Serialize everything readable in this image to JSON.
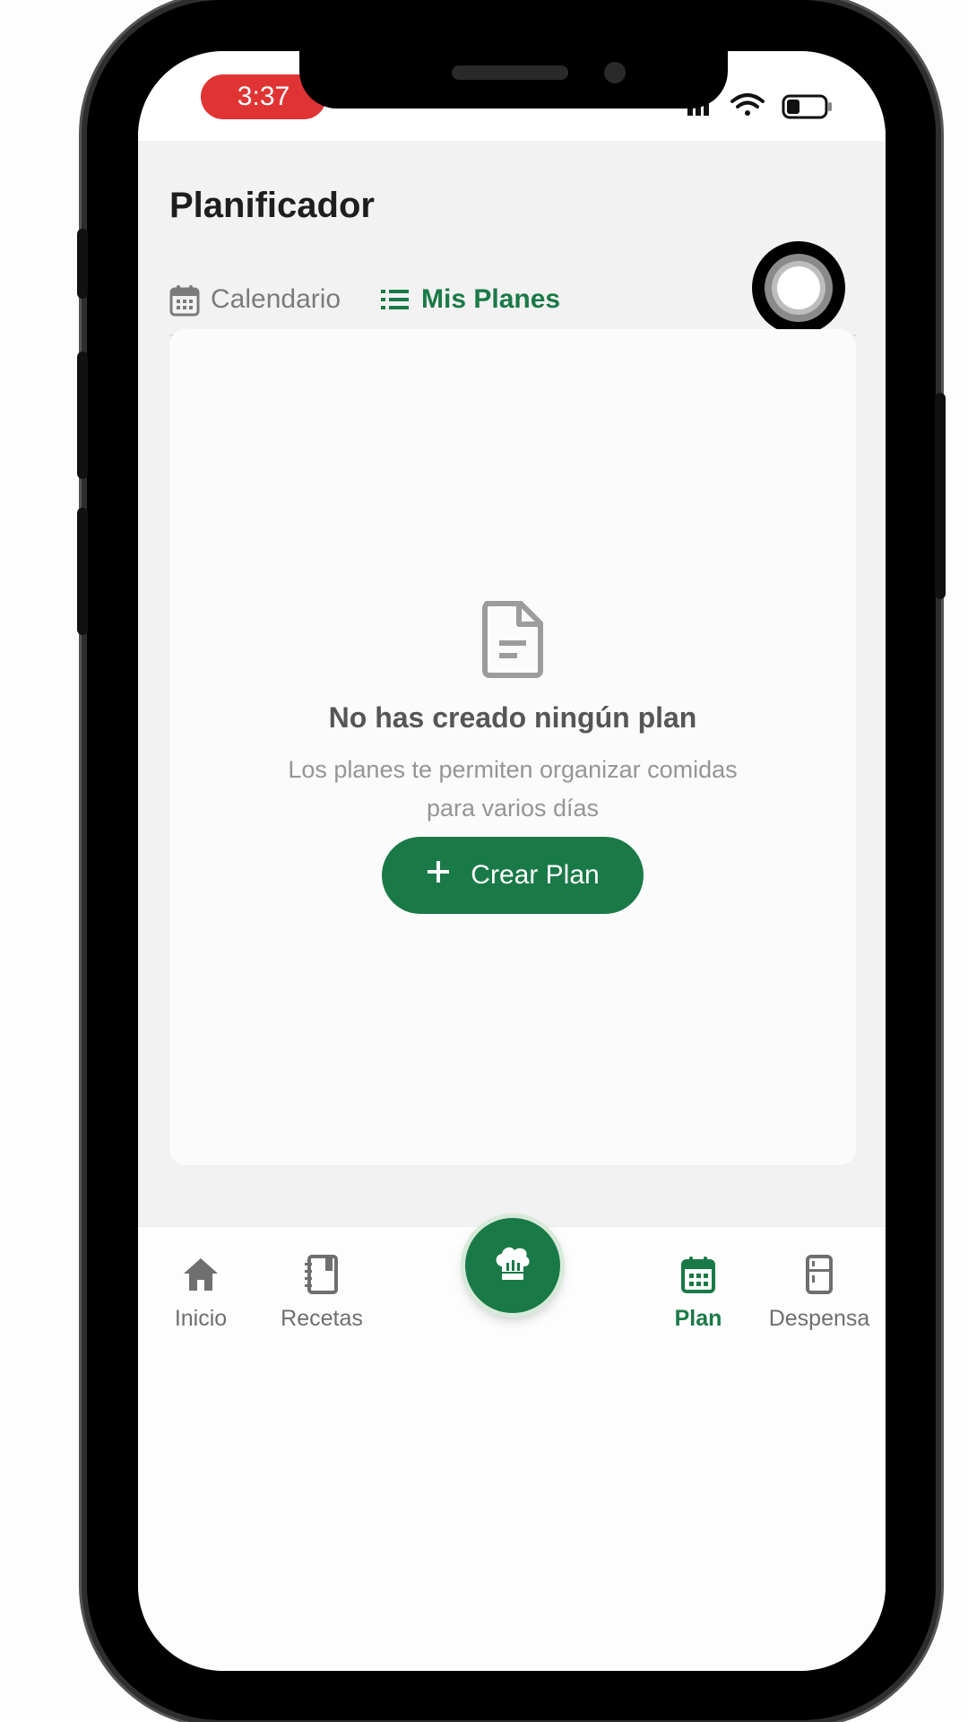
{
  "status_bar": {
    "time": "3:37"
  },
  "header": {
    "title": "Planificador"
  },
  "tabs": [
    {
      "label": "Calendario",
      "icon": "calendar-icon",
      "active": false
    },
    {
      "label": "Mis Planes",
      "icon": "list-icon",
      "active": true
    }
  ],
  "empty_state": {
    "icon": "document-icon",
    "title": "No has creado ningún plan",
    "subtitle_line1": "Los planes te permiten organizar comidas",
    "subtitle_line2": "para varios días",
    "button_label": "Crear Plan"
  },
  "bottom_nav": {
    "items": [
      {
        "label": "Inicio",
        "icon": "home-icon",
        "active": false
      },
      {
        "label": "Recetas",
        "icon": "recipe-book-icon",
        "active": false
      },
      {
        "label": "Plan",
        "icon": "calendar-icon",
        "active": true
      },
      {
        "label": "Despensa",
        "icon": "fridge-icon",
        "active": false
      }
    ],
    "center_button_icon": "chef-hat-icon"
  },
  "colors": {
    "accent": "#1a7a47",
    "time_pill": "#e03434",
    "background": "#f2f2f2"
  }
}
